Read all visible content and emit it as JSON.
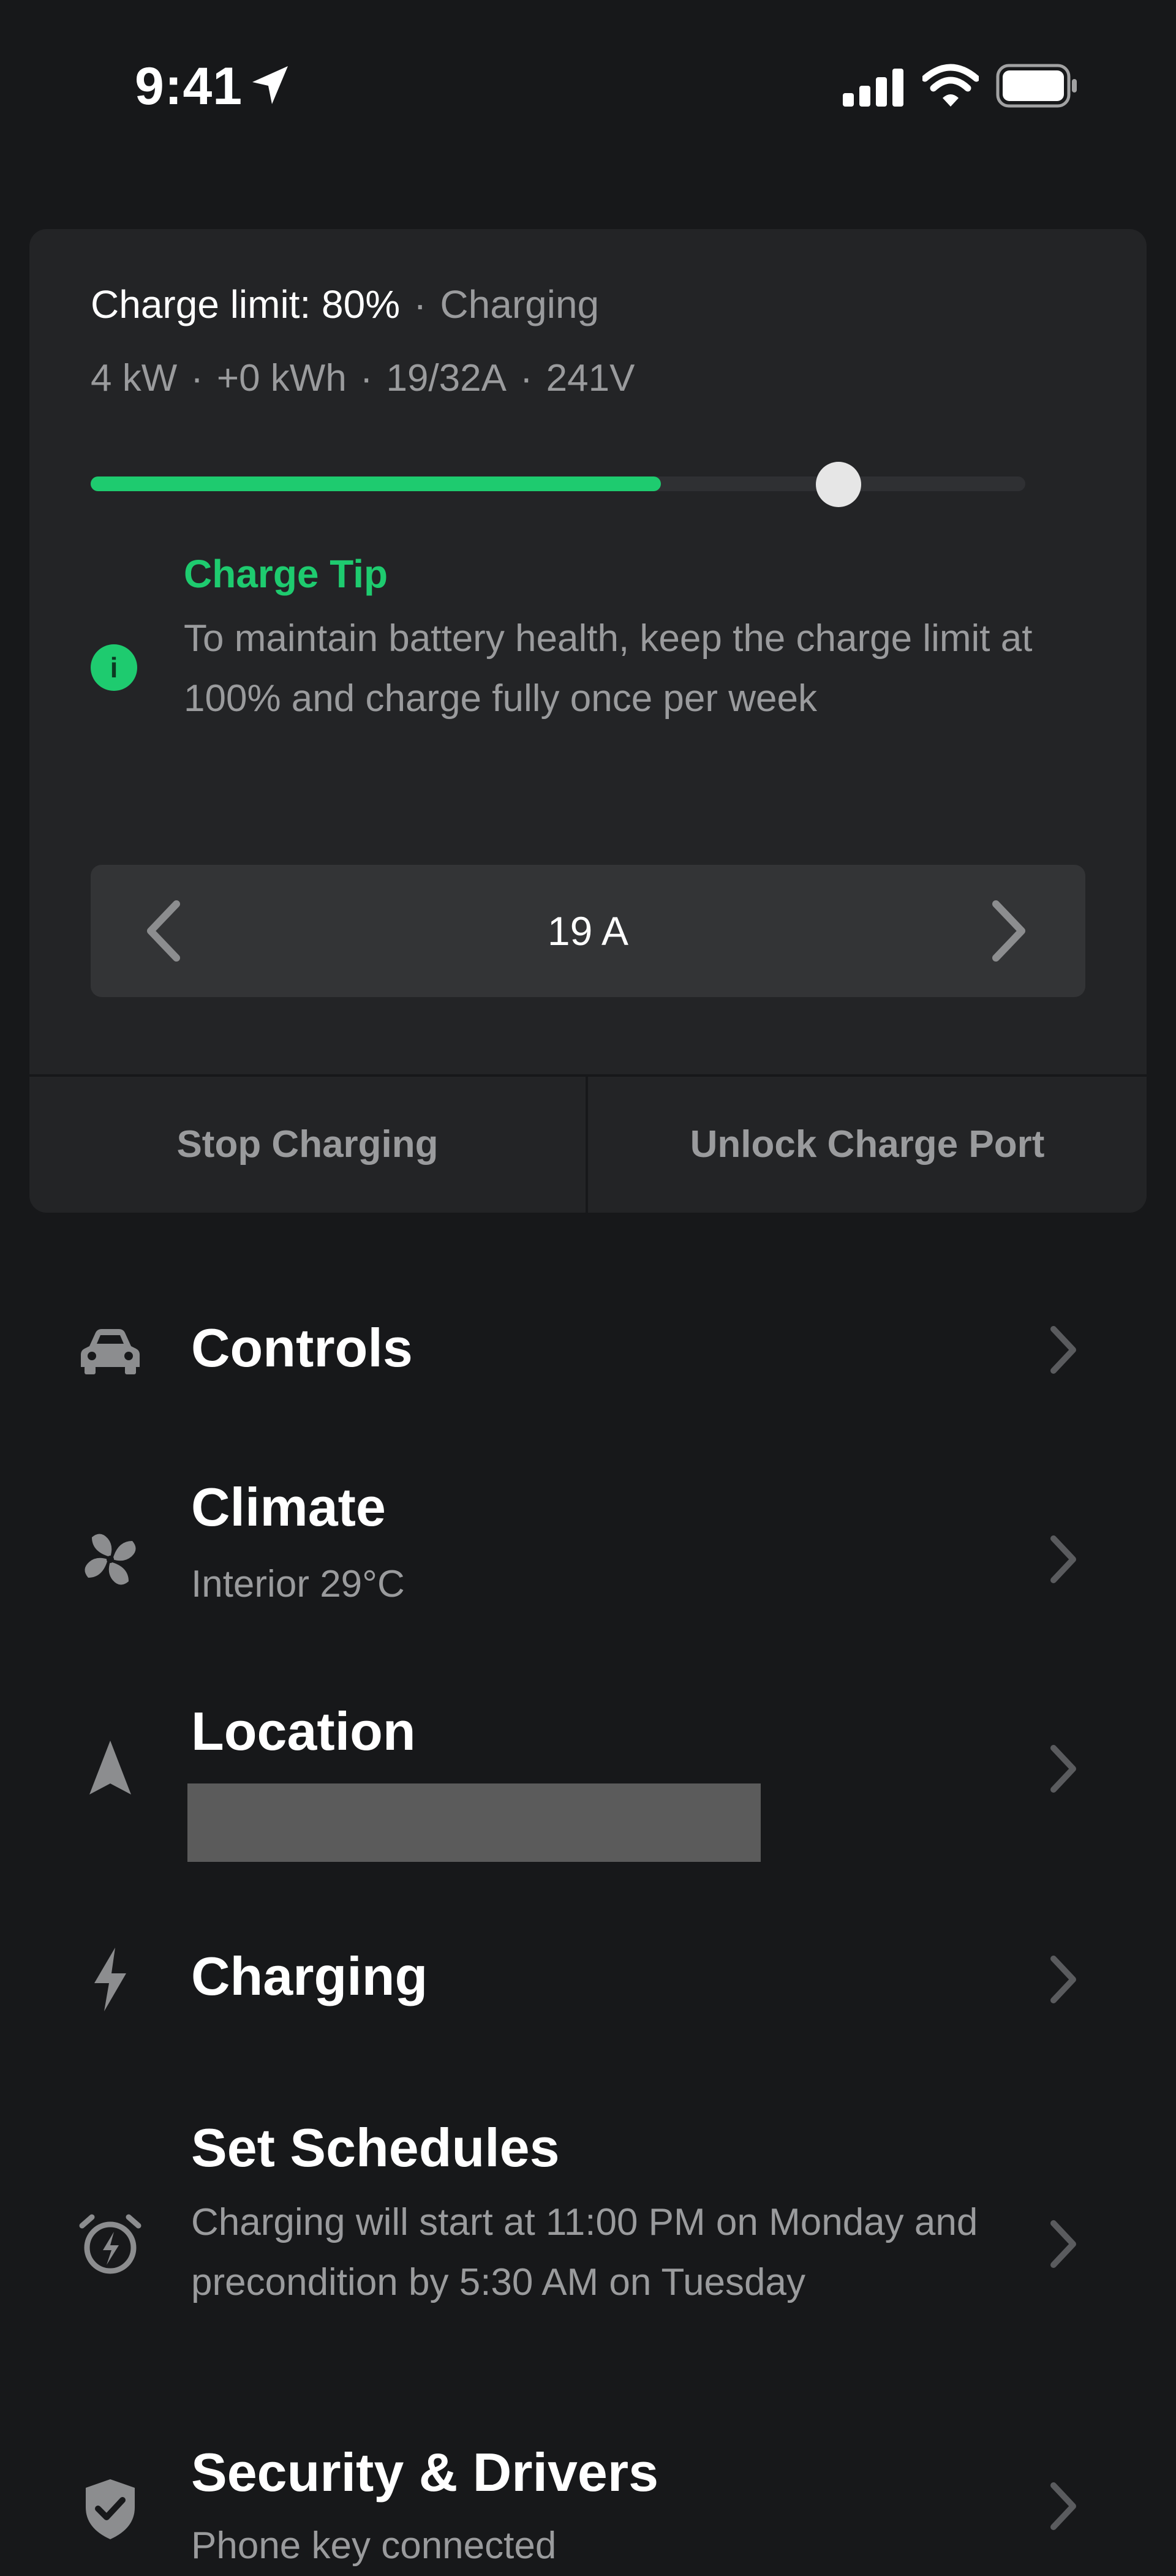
{
  "status_bar": {
    "time": "9:41"
  },
  "charge_card": {
    "limit_label": "Charge limit: 80%",
    "state": "Charging",
    "stats": [
      "4 kW",
      "+0 kWh",
      "19/32A",
      "241V"
    ],
    "charge_level": 0.61,
    "limit_level": 0.8,
    "tip_title": "Charge Tip",
    "tip_body": "To maintain battery health, keep the charge limit at 100% and charge fully once per week",
    "amperage": "19 A",
    "stop_label": "Stop Charging",
    "unlock_label": "Unlock Charge Port"
  },
  "menu": {
    "controls": {
      "title": "Controls"
    },
    "climate": {
      "title": "Climate",
      "subtitle": "Interior 29°C"
    },
    "location": {
      "title": "Location"
    },
    "charging": {
      "title": "Charging"
    },
    "schedules": {
      "title": "Set Schedules",
      "subtitle": "Charging will start at 11:00 PM on Monday and precondition by 5:30 AM on Tuesday"
    },
    "security": {
      "title": "Security & Drivers",
      "subtitle": "Phone key connected"
    }
  },
  "colors": {
    "accent": "#1ecb6f",
    "background": "#17181a",
    "card": "#232426"
  },
  "icons": [
    "location-arrow-icon",
    "signal-icon",
    "wifi-icon",
    "battery-icon",
    "info-icon",
    "chevron-left-icon",
    "chevron-right-icon",
    "car-icon",
    "fan-icon",
    "navigation-arrow-icon",
    "bolt-icon",
    "alarm-clock-icon",
    "shield-check-icon"
  ]
}
